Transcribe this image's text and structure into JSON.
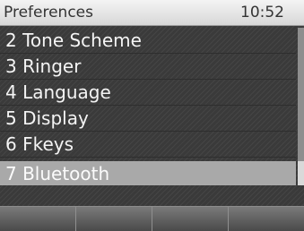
{
  "header": {
    "title": "Preferences",
    "time": "10:52"
  },
  "menu": {
    "items": [
      {
        "label": "2 Tone Scheme",
        "selected": false
      },
      {
        "label": "3 Ringer",
        "selected": false
      },
      {
        "label": "4 Language",
        "selected": false
      },
      {
        "label": "5 Display",
        "selected": false
      },
      {
        "label": "6 Fkeys",
        "selected": false
      },
      {
        "label": "7 Bluetooth",
        "selected": true
      }
    ]
  },
  "softkeys": [
    "",
    "",
    "",
    ""
  ],
  "colors": {
    "selection": "#a9a9a9",
    "background": "#3f3f3f",
    "header": "#e6e6e6"
  }
}
